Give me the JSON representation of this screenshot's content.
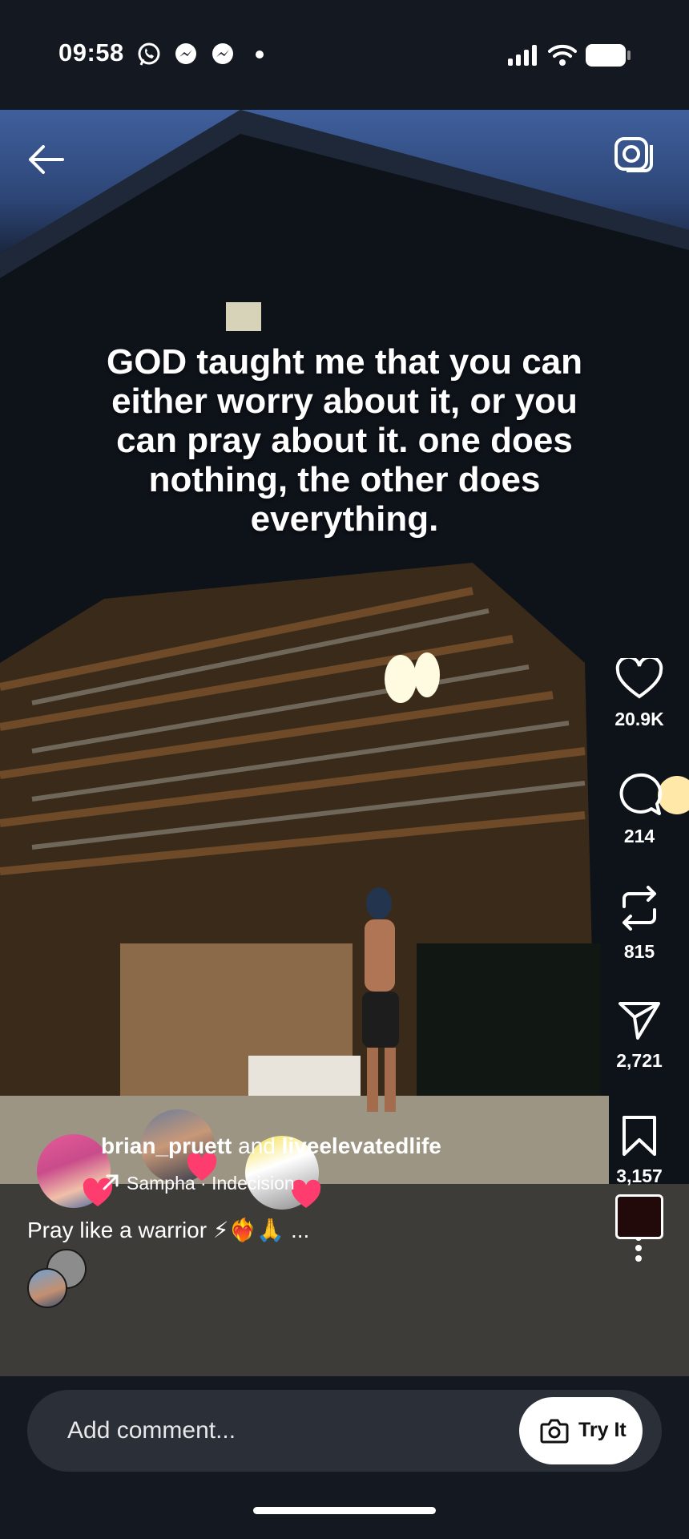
{
  "status_bar": {
    "time": "09:58"
  },
  "video": {
    "quote": "GOD taught me that you can either worry about it, or you can pray about it. one does nothing, the other does everything."
  },
  "actions": {
    "likes": "20.9K",
    "comments": "214",
    "reposts": "815",
    "shares": "2,721",
    "saves": "3,157"
  },
  "post": {
    "author": "brian_pruett",
    "connector": " and ",
    "collaborator": "liveelevatedlife",
    "music": "Sampha · Indecision",
    "caption": "Pray like a warrior ⚡❤️‍🔥🙏 ..."
  },
  "comment_bar": {
    "placeholder": "Add comment...",
    "try_label": "Try It"
  },
  "colors": {
    "heart_badge": "#ff3c6e",
    "background": "#141820"
  }
}
